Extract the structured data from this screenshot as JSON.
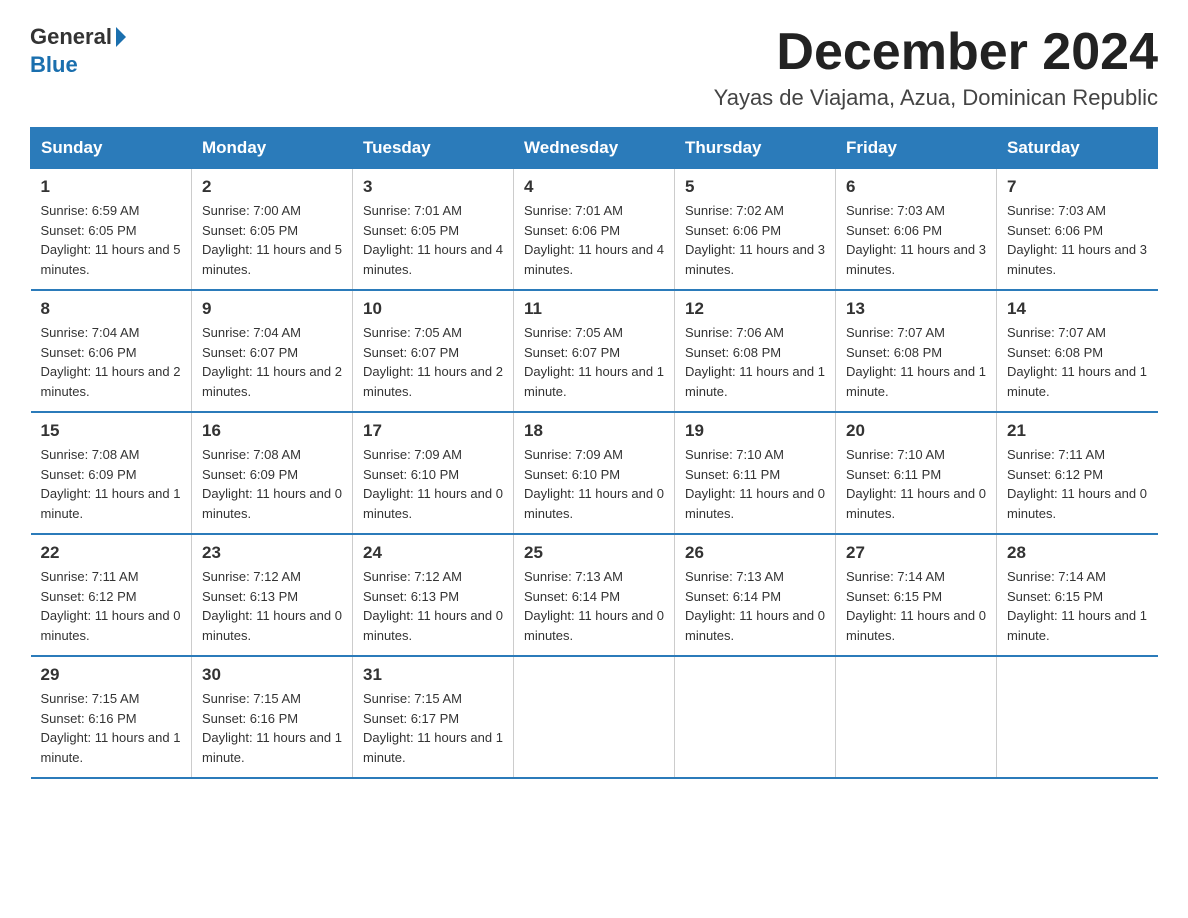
{
  "logo": {
    "general": "General",
    "blue": "Blue"
  },
  "header": {
    "month_title": "December 2024",
    "location": "Yayas de Viajama, Azua, Dominican Republic"
  },
  "weekdays": [
    "Sunday",
    "Monday",
    "Tuesday",
    "Wednesday",
    "Thursday",
    "Friday",
    "Saturday"
  ],
  "weeks": [
    [
      {
        "day": "1",
        "sunrise": "6:59 AM",
        "sunset": "6:05 PM",
        "daylight": "11 hours and 5 minutes."
      },
      {
        "day": "2",
        "sunrise": "7:00 AM",
        "sunset": "6:05 PM",
        "daylight": "11 hours and 5 minutes."
      },
      {
        "day": "3",
        "sunrise": "7:01 AM",
        "sunset": "6:05 PM",
        "daylight": "11 hours and 4 minutes."
      },
      {
        "day": "4",
        "sunrise": "7:01 AM",
        "sunset": "6:06 PM",
        "daylight": "11 hours and 4 minutes."
      },
      {
        "day": "5",
        "sunrise": "7:02 AM",
        "sunset": "6:06 PM",
        "daylight": "11 hours and 3 minutes."
      },
      {
        "day": "6",
        "sunrise": "7:03 AM",
        "sunset": "6:06 PM",
        "daylight": "11 hours and 3 minutes."
      },
      {
        "day": "7",
        "sunrise": "7:03 AM",
        "sunset": "6:06 PM",
        "daylight": "11 hours and 3 minutes."
      }
    ],
    [
      {
        "day": "8",
        "sunrise": "7:04 AM",
        "sunset": "6:06 PM",
        "daylight": "11 hours and 2 minutes."
      },
      {
        "day": "9",
        "sunrise": "7:04 AM",
        "sunset": "6:07 PM",
        "daylight": "11 hours and 2 minutes."
      },
      {
        "day": "10",
        "sunrise": "7:05 AM",
        "sunset": "6:07 PM",
        "daylight": "11 hours and 2 minutes."
      },
      {
        "day": "11",
        "sunrise": "7:05 AM",
        "sunset": "6:07 PM",
        "daylight": "11 hours and 1 minute."
      },
      {
        "day": "12",
        "sunrise": "7:06 AM",
        "sunset": "6:08 PM",
        "daylight": "11 hours and 1 minute."
      },
      {
        "day": "13",
        "sunrise": "7:07 AM",
        "sunset": "6:08 PM",
        "daylight": "11 hours and 1 minute."
      },
      {
        "day": "14",
        "sunrise": "7:07 AM",
        "sunset": "6:08 PM",
        "daylight": "11 hours and 1 minute."
      }
    ],
    [
      {
        "day": "15",
        "sunrise": "7:08 AM",
        "sunset": "6:09 PM",
        "daylight": "11 hours and 1 minute."
      },
      {
        "day": "16",
        "sunrise": "7:08 AM",
        "sunset": "6:09 PM",
        "daylight": "11 hours and 0 minutes."
      },
      {
        "day": "17",
        "sunrise": "7:09 AM",
        "sunset": "6:10 PM",
        "daylight": "11 hours and 0 minutes."
      },
      {
        "day": "18",
        "sunrise": "7:09 AM",
        "sunset": "6:10 PM",
        "daylight": "11 hours and 0 minutes."
      },
      {
        "day": "19",
        "sunrise": "7:10 AM",
        "sunset": "6:11 PM",
        "daylight": "11 hours and 0 minutes."
      },
      {
        "day": "20",
        "sunrise": "7:10 AM",
        "sunset": "6:11 PM",
        "daylight": "11 hours and 0 minutes."
      },
      {
        "day": "21",
        "sunrise": "7:11 AM",
        "sunset": "6:12 PM",
        "daylight": "11 hours and 0 minutes."
      }
    ],
    [
      {
        "day": "22",
        "sunrise": "7:11 AM",
        "sunset": "6:12 PM",
        "daylight": "11 hours and 0 minutes."
      },
      {
        "day": "23",
        "sunrise": "7:12 AM",
        "sunset": "6:13 PM",
        "daylight": "11 hours and 0 minutes."
      },
      {
        "day": "24",
        "sunrise": "7:12 AM",
        "sunset": "6:13 PM",
        "daylight": "11 hours and 0 minutes."
      },
      {
        "day": "25",
        "sunrise": "7:13 AM",
        "sunset": "6:14 PM",
        "daylight": "11 hours and 0 minutes."
      },
      {
        "day": "26",
        "sunrise": "7:13 AM",
        "sunset": "6:14 PM",
        "daylight": "11 hours and 0 minutes."
      },
      {
        "day": "27",
        "sunrise": "7:14 AM",
        "sunset": "6:15 PM",
        "daylight": "11 hours and 0 minutes."
      },
      {
        "day": "28",
        "sunrise": "7:14 AM",
        "sunset": "6:15 PM",
        "daylight": "11 hours and 1 minute."
      }
    ],
    [
      {
        "day": "29",
        "sunrise": "7:15 AM",
        "sunset": "6:16 PM",
        "daylight": "11 hours and 1 minute."
      },
      {
        "day": "30",
        "sunrise": "7:15 AM",
        "sunset": "6:16 PM",
        "daylight": "11 hours and 1 minute."
      },
      {
        "day": "31",
        "sunrise": "7:15 AM",
        "sunset": "6:17 PM",
        "daylight": "11 hours and 1 minute."
      },
      null,
      null,
      null,
      null
    ]
  ]
}
